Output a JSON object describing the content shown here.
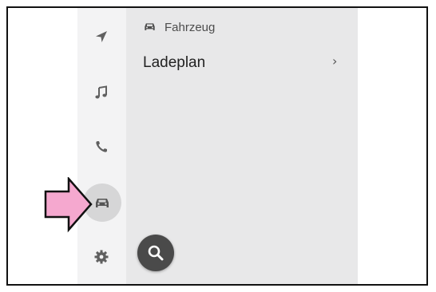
{
  "header": {
    "title": "Fahrzeug",
    "icon": "car-icon"
  },
  "menu": {
    "items": [
      {
        "label": "Ladeplan",
        "chevron": "›"
      }
    ]
  },
  "sidebar": {
    "items": [
      {
        "icon": "navigation-icon",
        "active": false
      },
      {
        "icon": "music-icon",
        "active": false
      },
      {
        "icon": "phone-icon",
        "active": false
      },
      {
        "icon": "car-icon",
        "active": true
      },
      {
        "icon": "settings-icon",
        "active": false
      }
    ]
  },
  "fab": {
    "icon": "search-icon"
  },
  "annotation": {
    "icon": "pointer-arrow",
    "color": "#f5a8cf"
  },
  "colors": {
    "panel": "#e8e8e9",
    "rail": "#f3f3f4",
    "active": "#d6d6d7",
    "fab": "#4a4a4a"
  }
}
